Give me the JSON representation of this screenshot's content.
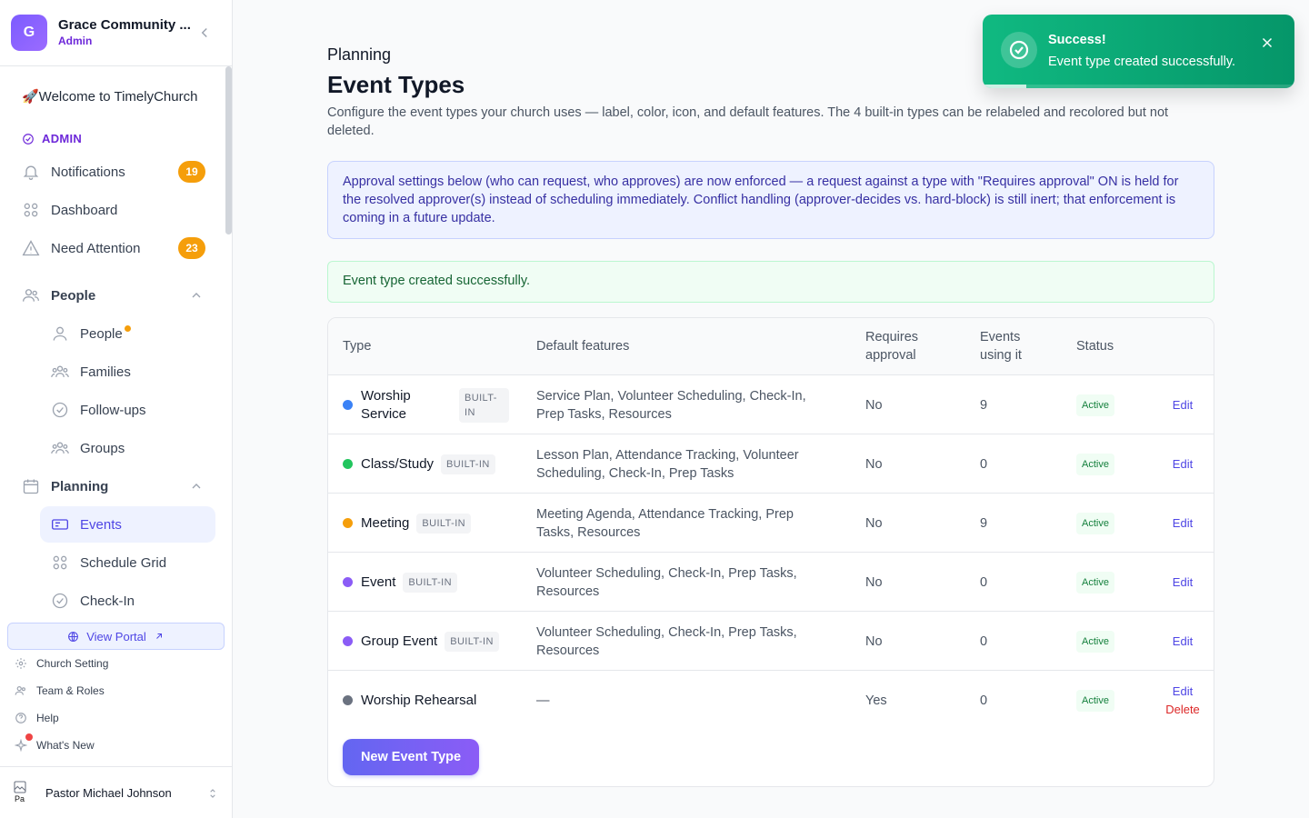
{
  "org": {
    "initial": "G",
    "name": "Grace Community ...",
    "role": "Admin"
  },
  "sidebar": {
    "welcome": "🚀Welcome to TimelyChurch",
    "admin_label": "ADMIN",
    "notifications": {
      "label": "Notifications",
      "count": "19"
    },
    "dashboard": {
      "label": "Dashboard"
    },
    "need_attention": {
      "label": "Need Attention",
      "count": "23"
    },
    "people_section": {
      "label": "People"
    },
    "people_items": [
      "People",
      "Families",
      "Follow-ups",
      "Groups"
    ],
    "planning_section": {
      "label": "Planning"
    },
    "planning_items": [
      "Events",
      "Schedule Grid",
      "Check-In"
    ],
    "view_portal": "View Portal",
    "footer": [
      "Church Setting",
      "Team & Roles",
      "Help",
      "What's New"
    ],
    "user": {
      "name": "Pastor Michael Johnson",
      "avatar_alt": "Pa"
    }
  },
  "page": {
    "breadcrumb": "Planning",
    "title": "Event Types",
    "description": "Configure the event types your church uses — label, color, icon, and default features. The 4 built-in types can be relabeled and recolored but not deleted.",
    "notice": "Approval settings below (who can request, who approves) are now enforced — a request against a type with \"Requires approval\" ON is held for the resolved approver(s) instead of scheduling immediately. Conflict handling (approver-decides vs. hard-block) is still inert; that enforcement is coming in a future update.",
    "success": "Event type created successfully."
  },
  "table": {
    "headers": {
      "type": "Type",
      "features": "Default features",
      "approval": "Requires approval",
      "events": "Events using it",
      "status": "Status"
    },
    "rows": [
      {
        "name": "Worship Service",
        "color": "#3b82f6",
        "badge": "BUILT-IN",
        "features": "Service Plan, Volunteer Scheduling, Check-In, Prep Tasks, Resources",
        "approval": "No",
        "events": "9",
        "status": "Active",
        "edit": "Edit",
        "delete": ""
      },
      {
        "name": "Class/Study",
        "color": "#22c55e",
        "badge": "BUILT-IN",
        "features": "Lesson Plan, Attendance Tracking, Volunteer Scheduling, Check-In, Prep Tasks",
        "approval": "No",
        "events": "0",
        "status": "Active",
        "edit": "Edit",
        "delete": ""
      },
      {
        "name": "Meeting",
        "color": "#f59e0b",
        "badge": "BUILT-IN",
        "features": "Meeting Agenda, Attendance Tracking, Prep Tasks, Resources",
        "approval": "No",
        "events": "9",
        "status": "Active",
        "edit": "Edit",
        "delete": ""
      },
      {
        "name": "Event",
        "color": "#8b5cf6",
        "badge": "BUILT-IN",
        "features": "Volunteer Scheduling, Check-In, Prep Tasks, Resources",
        "approval": "No",
        "events": "0",
        "status": "Active",
        "edit": "Edit",
        "delete": ""
      },
      {
        "name": "Group Event",
        "color": "#8b5cf6",
        "badge": "BUILT-IN",
        "features": "Volunteer Scheduling, Check-In, Prep Tasks, Resources",
        "approval": "No",
        "events": "0",
        "status": "Active",
        "edit": "Edit",
        "delete": ""
      },
      {
        "name": "Worship Rehearsal",
        "color": "#6b7280",
        "badge": "",
        "features": "—",
        "approval": "Yes",
        "events": "0",
        "status": "Active",
        "edit": "Edit",
        "delete": "Delete"
      }
    ],
    "new_button": "New Event Type"
  },
  "toast": {
    "title": "Success!",
    "message": "Event type created successfully.",
    "progress": 0.14
  },
  "colors": {
    "accent": "#4f46e5",
    "brand": "#7c5cff",
    "success": "#10b981",
    "warning": "#f59e0b"
  },
  "icons": [
    "chevron-left-icon",
    "bell-icon",
    "dashboard-grid-icon",
    "warning-triangle-icon",
    "users-icon",
    "user-icon",
    "families-icon",
    "check-circle-icon",
    "groups-icon",
    "calendar-icon",
    "ticket-icon",
    "grid-icon",
    "globe-icon",
    "external-link-icon",
    "gear-icon",
    "team-icon",
    "help-icon",
    "sparkle-icon",
    "chevron-up-icon",
    "chevron-updown-icon",
    "close-icon"
  ]
}
